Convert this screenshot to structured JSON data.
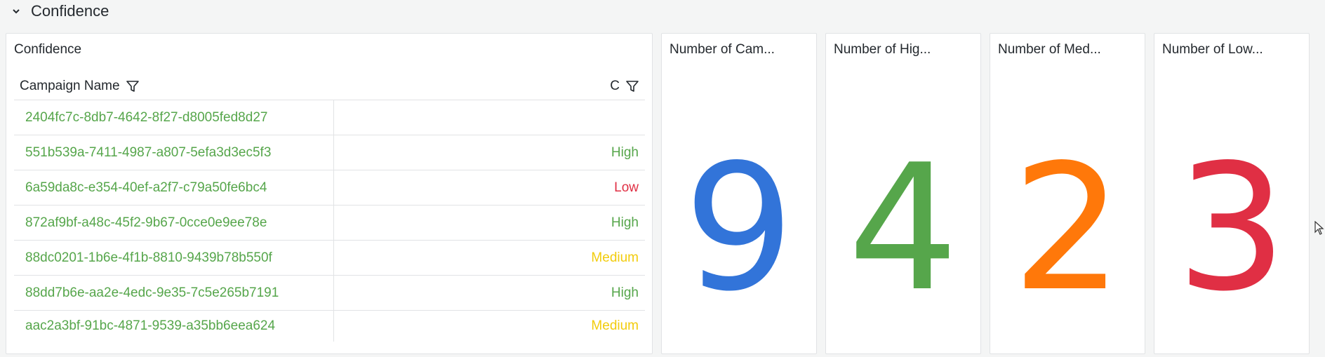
{
  "row": {
    "title": "Confidence"
  },
  "table_panel": {
    "title": "Confidence",
    "columns": {
      "name": "Campaign Name",
      "confidence": "C"
    },
    "rows": [
      {
        "name": "2404fc7c-8db7-4642-8f27-d8005fed8d27",
        "confidence": "",
        "color": "#56a64b"
      },
      {
        "name": "551b539a-7411-4987-a807-5efa3d3ec5f3",
        "confidence": "High",
        "color": "#56a64b"
      },
      {
        "name": "6a59da8c-e354-40ef-a2f7-c79a50fe6bc4",
        "confidence": "Low",
        "color": "#e02f44"
      },
      {
        "name": "872af9bf-a48c-45f2-9b67-0cce0e9ee78e",
        "confidence": "High",
        "color": "#56a64b"
      },
      {
        "name": "88dc0201-1b6e-4f1b-8810-9439b78b550f",
        "confidence": "Medium",
        "color": "#f2cc0c"
      },
      {
        "name": "88dd7b6e-aa2e-4edc-9e35-7c5e265b7191",
        "confidence": "High",
        "color": "#56a64b"
      },
      {
        "name": "aac2a3bf-91bc-4871-9539-a35bb6eea624",
        "confidence": "Medium",
        "color": "#f2cc0c"
      }
    ]
  },
  "stats": [
    {
      "title": "Number of Cam...",
      "value": "9",
      "color": "#3274d9"
    },
    {
      "title": "Number of Hig...",
      "value": "4",
      "color": "#56a64b"
    },
    {
      "title": "Number of Med...",
      "value": "2",
      "color": "#ff780a"
    },
    {
      "title": "Number of Low...",
      "value": "3",
      "color": "#e02f44"
    }
  ],
  "icons": {
    "collapse": "chevron-down-icon",
    "filter": "filter-icon",
    "cursor": "mouse-pointer-icon"
  }
}
